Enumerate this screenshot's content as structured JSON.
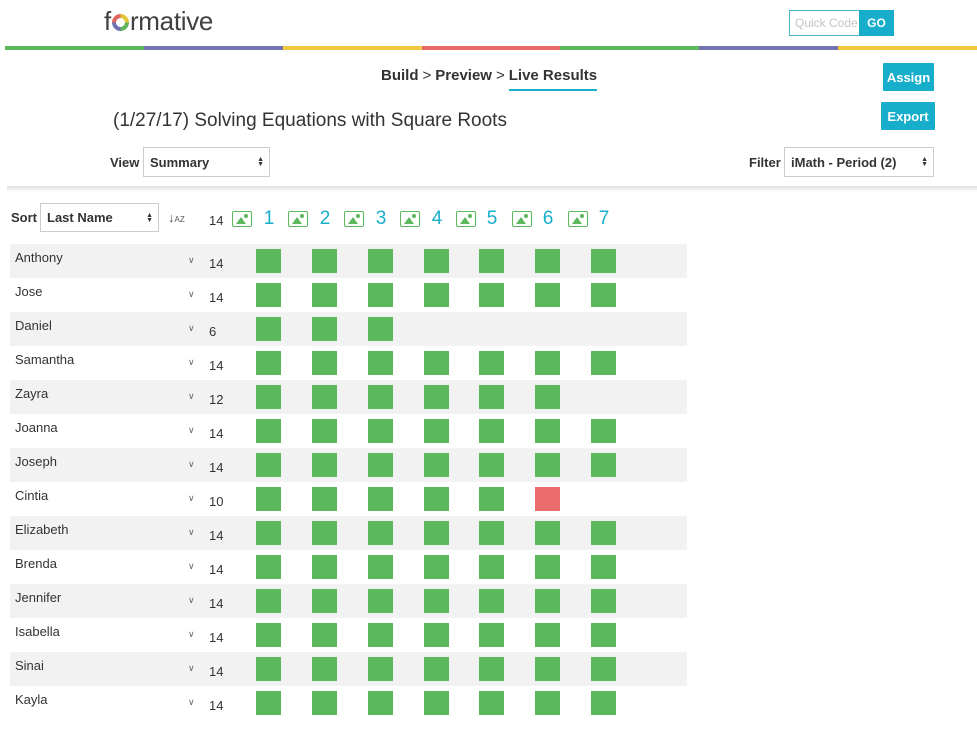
{
  "app": {
    "logo_text": "formative"
  },
  "quick_code": {
    "placeholder": "Quick Code",
    "go_label": "GO"
  },
  "stripe_colors": [
    "#5cb85c",
    "#7373b3",
    "#f0c93e",
    "#e8696a",
    "#5cb85c",
    "#7373b3",
    "#f0c93e"
  ],
  "breadcrumb": {
    "build": "Build",
    "preview": "Preview",
    "live_results": "Live Results",
    "separator": ">"
  },
  "actions": {
    "assign_label": "Assign",
    "export_label": "Export"
  },
  "page_title": "(1/27/17) Solving Equations with Square Roots",
  "view": {
    "label": "View",
    "selected": "Summary"
  },
  "filter": {
    "label": "Filter",
    "selected": "iMath - Period (2)"
  },
  "sort": {
    "label": "Sort",
    "selected": "Last Name"
  },
  "header": {
    "total": "14",
    "questions": [
      "1",
      "2",
      "3",
      "4",
      "5",
      "6",
      "7"
    ]
  },
  "colors": {
    "correct": "#5cb85c",
    "incorrect": "#ea6b6b",
    "accent": "#17aecb"
  },
  "students": [
    {
      "name": "Anthony",
      "score": "14",
      "results": [
        "correct",
        "correct",
        "correct",
        "correct",
        "correct",
        "correct",
        "correct"
      ]
    },
    {
      "name": "Jose",
      "score": "14",
      "results": [
        "correct",
        "correct",
        "correct",
        "correct",
        "correct",
        "correct",
        "correct"
      ]
    },
    {
      "name": "Daniel",
      "score": "6",
      "results": [
        "correct",
        "correct",
        "correct",
        "",
        "",
        "",
        ""
      ]
    },
    {
      "name": "Samantha",
      "score": "14",
      "results": [
        "correct",
        "correct",
        "correct",
        "correct",
        "correct",
        "correct",
        "correct"
      ]
    },
    {
      "name": "Zayra",
      "score": "12",
      "results": [
        "correct",
        "correct",
        "correct",
        "correct",
        "correct",
        "correct",
        ""
      ]
    },
    {
      "name": "Joanna",
      "score": "14",
      "results": [
        "correct",
        "correct",
        "correct",
        "correct",
        "correct",
        "correct",
        "correct"
      ]
    },
    {
      "name": "Joseph",
      "score": "14",
      "results": [
        "correct",
        "correct",
        "correct",
        "correct",
        "correct",
        "correct",
        "correct"
      ]
    },
    {
      "name": "Cintia",
      "score": "10",
      "results": [
        "correct",
        "correct",
        "correct",
        "correct",
        "correct",
        "incorrect",
        ""
      ]
    },
    {
      "name": "Elizabeth",
      "score": "14",
      "results": [
        "correct",
        "correct",
        "correct",
        "correct",
        "correct",
        "correct",
        "correct"
      ]
    },
    {
      "name": "Brenda",
      "score": "14",
      "results": [
        "correct",
        "correct",
        "correct",
        "correct",
        "correct",
        "correct",
        "correct"
      ]
    },
    {
      "name": "Jennifer",
      "score": "14",
      "results": [
        "correct",
        "correct",
        "correct",
        "correct",
        "correct",
        "correct",
        "correct"
      ]
    },
    {
      "name": "Isabella",
      "score": "14",
      "results": [
        "correct",
        "correct",
        "correct",
        "correct",
        "correct",
        "correct",
        "correct"
      ]
    },
    {
      "name": "Sinai",
      "score": "14",
      "results": [
        "correct",
        "correct",
        "correct",
        "correct",
        "correct",
        "correct",
        "correct"
      ]
    },
    {
      "name": "Kayla",
      "score": "14",
      "results": [
        "correct",
        "correct",
        "correct",
        "correct",
        "correct",
        "correct",
        "correct"
      ]
    }
  ]
}
